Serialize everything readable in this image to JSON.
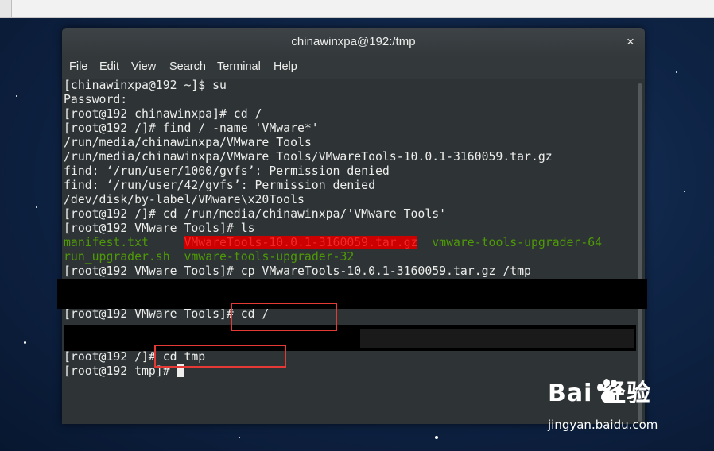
{
  "window": {
    "title": "chinawinxpa@192:/tmp",
    "close_label": "×"
  },
  "menu": [
    "File",
    "Edit",
    "View",
    "Search",
    "Terminal",
    "Help"
  ],
  "terminal": {
    "lines": [
      "[chinawinxpa@192 ~]$ su",
      "Password:",
      "[root@192 chinawinxpa]# cd /",
      "[root@192 /]# find / -name 'VMware*'",
      "/run/media/chinawinxpa/VMware Tools",
      "/run/media/chinawinxpa/VMware Tools/VMwareTools-10.0.1-3160059.tar.gz",
      "find: ‘/run/user/1000/gvfs’: Permission denied",
      "find: ‘/run/user/42/gvfs’: Permission denied",
      "/dev/disk/by-label/VMware\\x20Tools",
      "[root@192 /]# cd /run/media/chinawinxpa/'VMware Tools'",
      "[root@192 VMware Tools]# ls"
    ],
    "ls_row1": {
      "a": "manifest.txt",
      "b": "VMwareTools-10.0.1-3160059.tar.gz",
      "c": "vmware-tools-upgrader-64"
    },
    "ls_row2": {
      "a": "run_upgrader.sh",
      "b": "vmware-tools-upgrader-32"
    },
    "cp_line": "[root@192 VMware Tools]# cp VMwareTools-10.0.1-3160059.tar.gz /tmp",
    "cd_root_line": "[root@192 VMware Tools]# cd /",
    "cd_tmp_line": "[root@192 /]# cd tmp",
    "prompt_line": "[root@192 tmp]# "
  },
  "watermark": {
    "logo": "Bai  经验",
    "url": "jingyan.baidu.com"
  },
  "colors": {
    "terminal_bg": "#2e3436",
    "highlight_red": "#e53935",
    "ls_green": "#4e9a06"
  }
}
